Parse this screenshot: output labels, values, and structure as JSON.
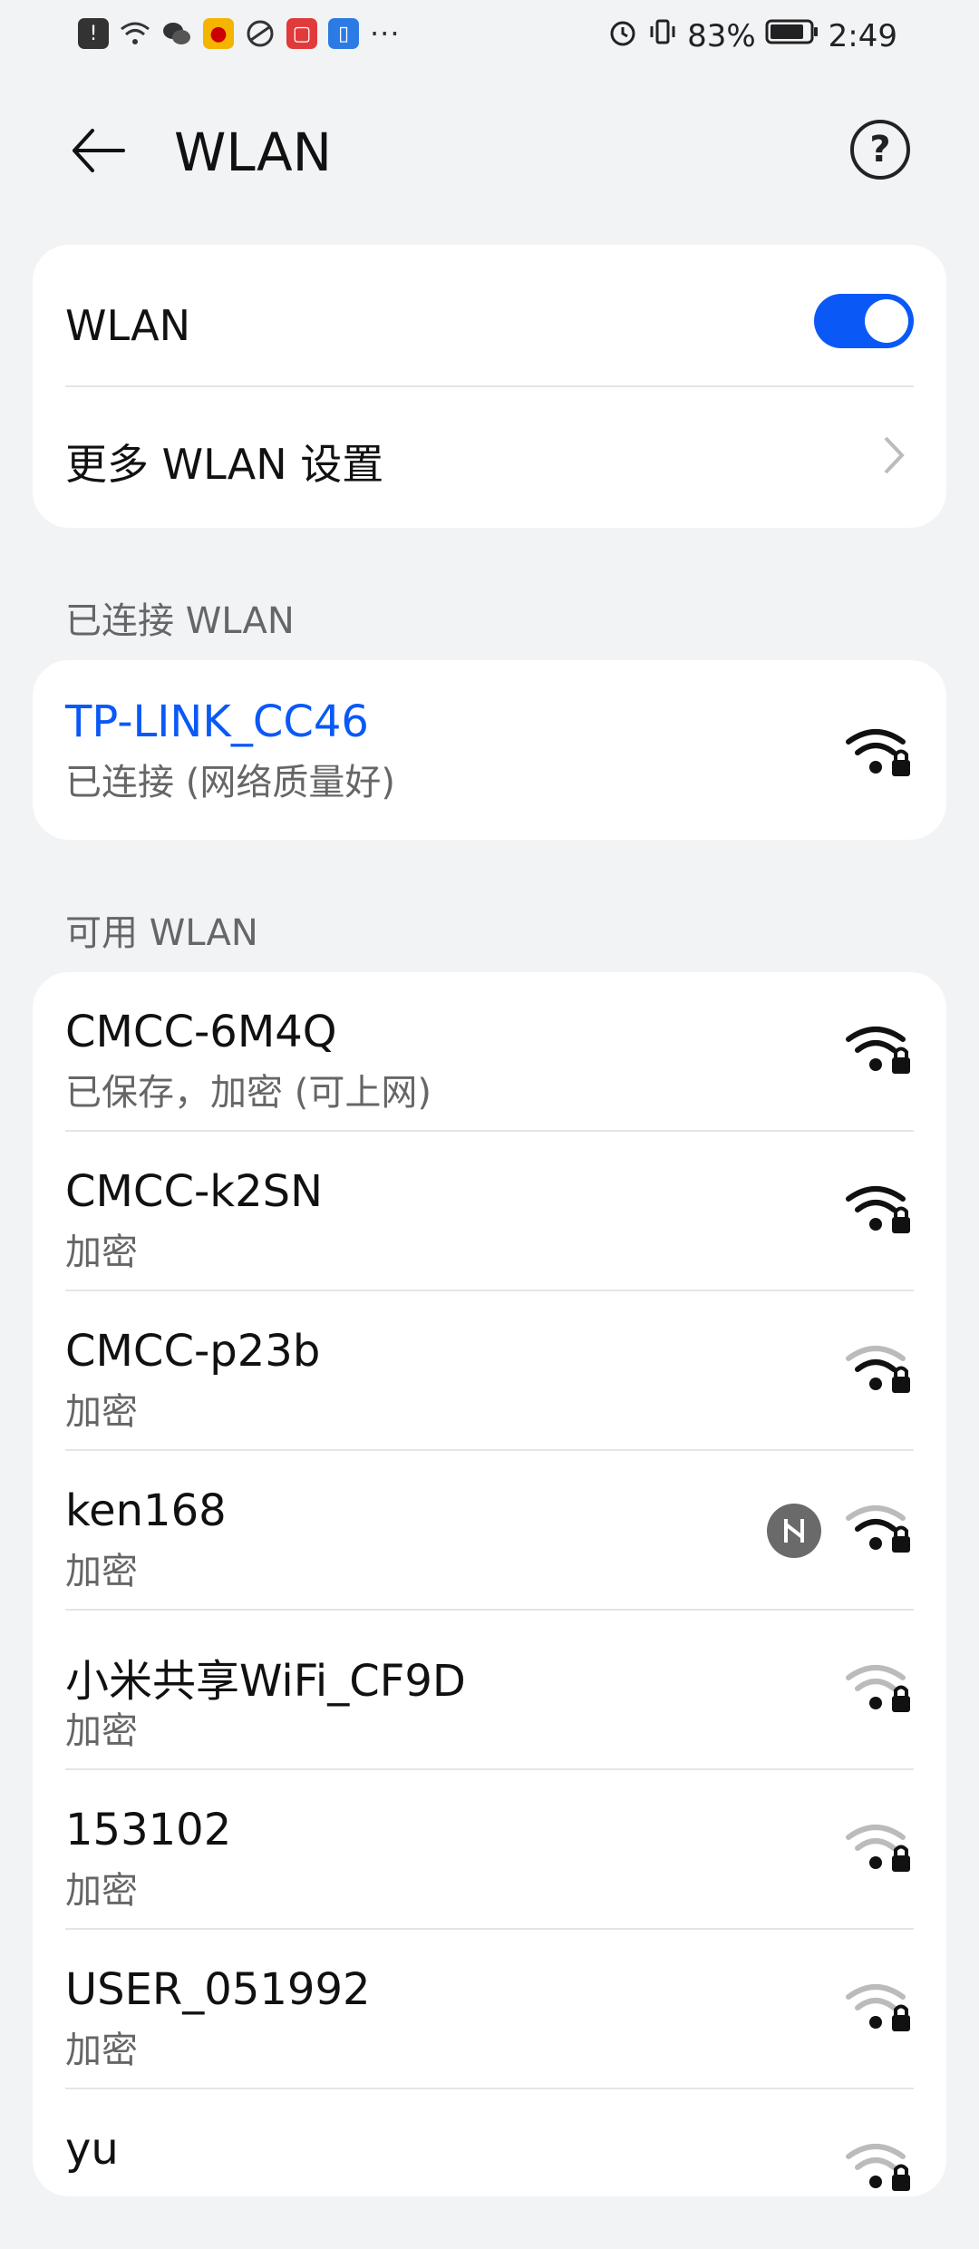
{
  "status": {
    "left_icons": [
      "notification-icon",
      "wifi-icon",
      "wechat-icon",
      "weibo-icon",
      "browser-icon",
      "app-red-icon",
      "app-blue-icon"
    ],
    "more": "···",
    "battery": "83%",
    "time": "2:49"
  },
  "header": {
    "title": "WLAN"
  },
  "main_card": {
    "wlan_label": "WLAN",
    "wlan_on": true,
    "more_settings_label": "更多 WLAN 设置"
  },
  "sections": {
    "connected": "已连接 WLAN",
    "available": "可用 WLAN"
  },
  "connected_network": {
    "name": "TP-LINK_CC46",
    "status": "已连接 (网络质量好)"
  },
  "available_networks": [
    {
      "name": "CMCC-6M4Q",
      "status": "已保存，加密 (可上网)",
      "strength": "strong",
      "hilink": false
    },
    {
      "name": "CMCC-k2SN",
      "status": "加密",
      "strength": "strong",
      "hilink": false
    },
    {
      "name": "CMCC-p23b",
      "status": "加密",
      "strength": "medium",
      "hilink": false
    },
    {
      "name": "ken168",
      "status": "加密",
      "strength": "medium",
      "hilink": true
    },
    {
      "name": "小米共享WiFi_CF9D",
      "status": "加密",
      "strength": "weak",
      "hilink": false
    },
    {
      "name": "153102",
      "status": "加密",
      "strength": "weak",
      "hilink": false
    },
    {
      "name": "USER_051992",
      "status": "加密",
      "strength": "weak",
      "hilink": false
    },
    {
      "name": "yu",
      "status": "",
      "strength": "weak",
      "hilink": false
    }
  ],
  "colors": {
    "accent": "#0a59f7",
    "background": "#f1f3f5"
  }
}
